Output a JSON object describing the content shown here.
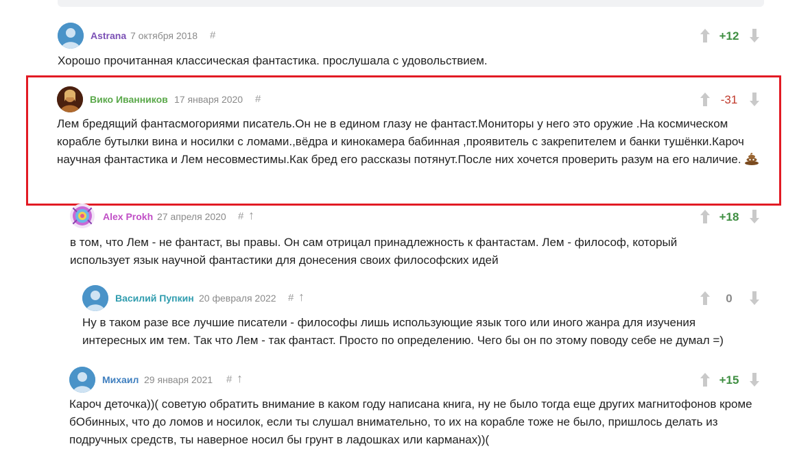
{
  "comments": [
    {
      "author": "Astrana",
      "author_color": "#7a4fb5",
      "date": "7 октября 2018",
      "hash": "#",
      "score": "+12",
      "score_color": "#3e8e41",
      "text": "Хорошо прочитанная классическая фантастика. прослушала с удовольствием.",
      "avatar": "default-avatar-icon"
    },
    {
      "author": "Вико Иванников",
      "author_color": "#5aa84a",
      "date": "17 января 2020",
      "hash": "#",
      "score": "-31",
      "score_color": "#c0392b",
      "text": "Лем бредящий фантасмогориями писатель.Он не в едином глазу не фантаст.Мониторы у него это оружие .На космическом корабле бутылки вина и носилки с ломами.,вёдра и кинокамера бабинная ,проявитель с закрепителем и банки тушёнки.Кароч научная фантастика и Лем несовместимы.Как бред его рассказы потянут.После них хочется проверить разум на его наличие.",
      "emoji": "poop-emoji-icon",
      "avatar": "photo-avatar"
    },
    {
      "author": "Alex Prokh",
      "author_color": "#c04fc6",
      "date": "27 апреля 2020",
      "hash": "#",
      "parent_arrow": "↑",
      "score": "+18",
      "score_color": "#3e8e41",
      "text": "в том, что Лем - не фантаст, вы правы. Он сам отрицал принадлежность к фантастам. Лем - философ, который использует язык научной фантастики для донесения своих философских идей",
      "avatar": "colorful-avatar"
    },
    {
      "author": "Василий Пупкин",
      "author_color": "#2f9cae",
      "date": "20 февраля 2022",
      "hash": "#",
      "parent_arrow": "↑",
      "score": "0",
      "score_color": "#8a8a8a",
      "text": "Ну в таком разе все лучшие писатели - философы лишь использующие язык того или иного жанра для изучения интересных им тем. Так что Лем - так фантаст. Просто по определению. Чего бы он по этому поводу себе не думал =)",
      "avatar": "default-avatar-icon"
    },
    {
      "author": "Михаил",
      "author_color": "#3f7fbf",
      "date": "29 января 2021",
      "hash": "#",
      "parent_arrow": "↑",
      "score": "+15",
      "score_color": "#3e8e41",
      "text": "Кароч деточка))( советую обратить внимание в каком году написана книга, ну не было тогда еще других магнитофонов кроме бОбинных, что до ломов и носилок, если ты слушал внимательно, то их на корабле тоже не было, пришлось делать из подручных средств, ты наверное носил бы грунт в ладошках или карманах))(",
      "avatar": "default-avatar-icon"
    }
  ],
  "highlight_color": "#e21a24"
}
